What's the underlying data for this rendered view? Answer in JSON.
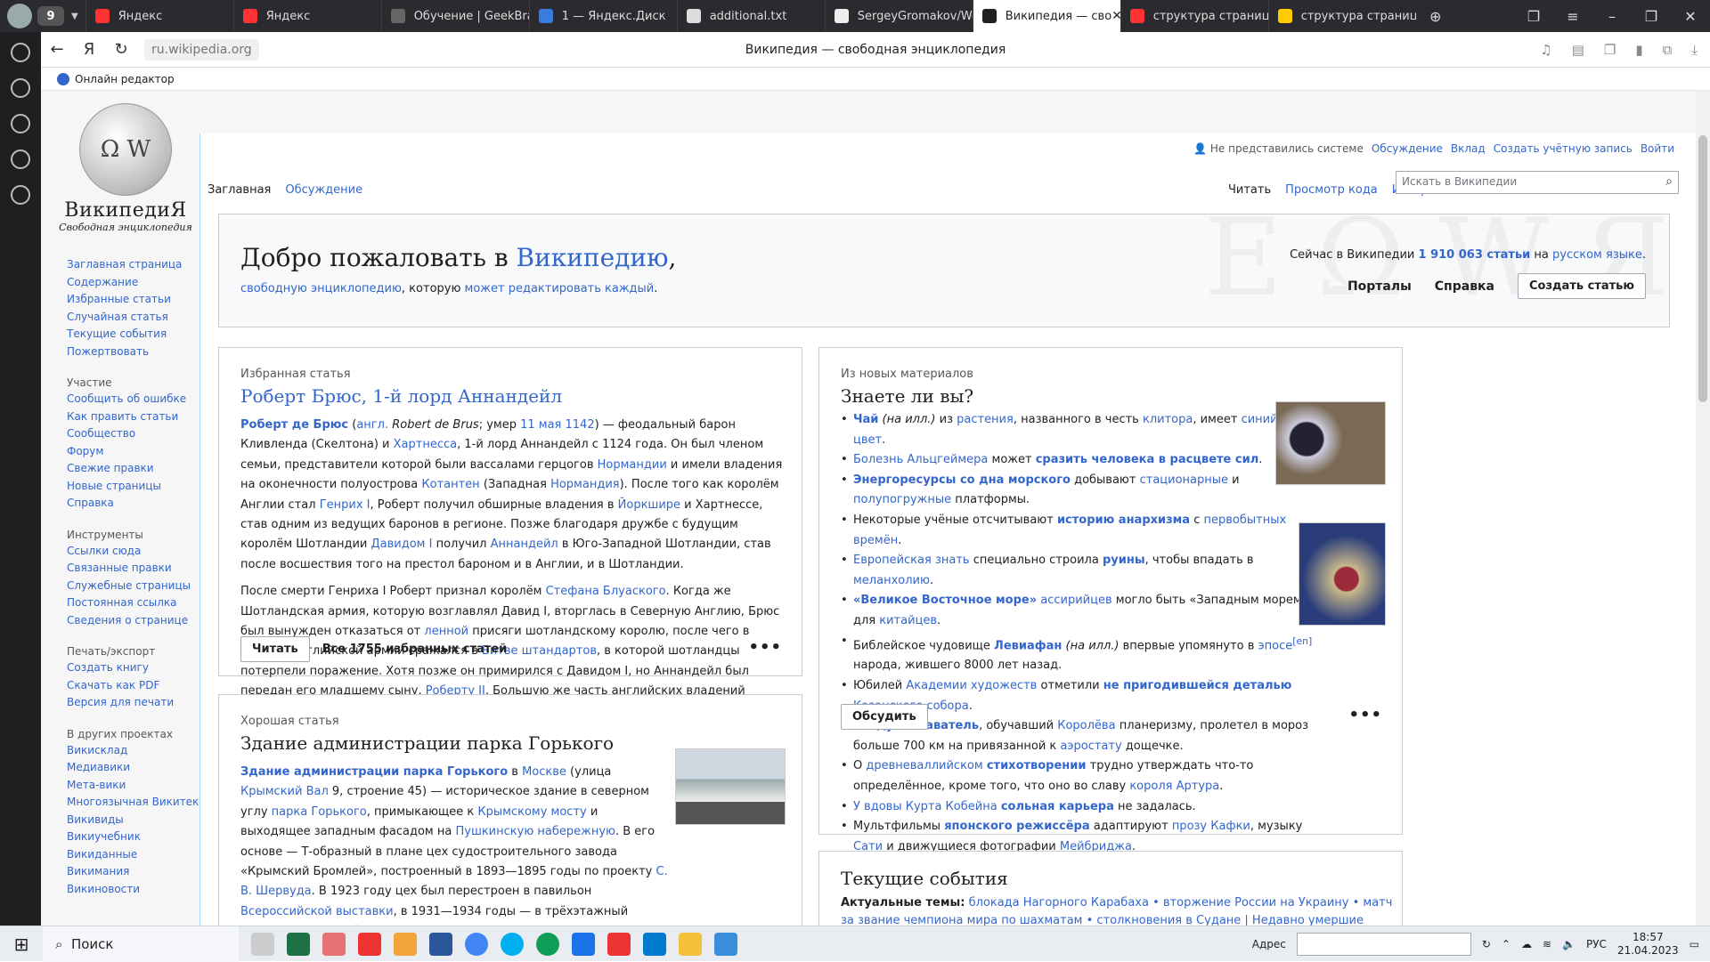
{
  "browser": {
    "tab_count": "9",
    "tabs": [
      {
        "title": "Яндекс",
        "color": "#f33"
      },
      {
        "title": "Яндекс",
        "color": "#f33"
      },
      {
        "title": "Обучение | GeekBrai",
        "color": "#666"
      },
      {
        "title": "1 — Яндекс.Диск",
        "color": "#3a7be0"
      },
      {
        "title": "additional.txt",
        "color": "#ddd"
      },
      {
        "title": "SergeyGromakov/We",
        "color": "#eee"
      },
      {
        "title": "Википедия — сво",
        "color": "#222",
        "active": true
      },
      {
        "title": "структура страницы",
        "color": "#f33"
      },
      {
        "title": "структура страницы",
        "color": "#fc0"
      }
    ],
    "url": "ru.wikipedia.org",
    "page_title": "Википедия — свободная энциклопедия",
    "bookmark": "Онлайн редактор"
  },
  "wiki": {
    "logo_name": "ВикипедиЯ",
    "logo_slogan": "Свободная энциклопедия",
    "nav_main": [
      "Заглавная страница",
      "Содержание",
      "Избранные статьи",
      "Случайная статья",
      "Текущие события",
      "Пожертвовать"
    ],
    "nav_part_title": "Участие",
    "nav_part": [
      "Сообщить об ошибке",
      "Как править статьи",
      "Сообщество",
      "Форум",
      "Свежие правки",
      "Новые страницы",
      "Справка"
    ],
    "nav_tools_title": "Инструменты",
    "nav_tools": [
      "Ссылки сюда",
      "Связанные правки",
      "Служебные страницы",
      "Постоянная ссылка",
      "Сведения о странице"
    ],
    "nav_print_title": "Печать/экспорт",
    "nav_print": [
      "Создать книгу",
      "Скачать как PDF",
      "Версия для печати"
    ],
    "nav_other_title": "В других проектах",
    "nav_other": [
      "Викисклад",
      "Медиавики",
      "Мета-вики",
      "Многоязычная Викитека",
      "Викивиды",
      "Викиучебник",
      "Викиданные",
      "Викимания",
      "Викиновости"
    ],
    "personal": {
      "user": "Не представились системе",
      "talk": "Обсуждение",
      "contrib": "Вклад",
      "create": "Создать учётную запись",
      "login": "Войти"
    },
    "ns_tabs": [
      "Заглавная",
      "Обсуждение"
    ],
    "view_tabs": [
      "Читать",
      "Просмотр кода",
      "История"
    ],
    "search_placeholder": "Искать в Википедии",
    "banner": {
      "title_a": "Добро пожаловать в ",
      "title_link": "Википедию",
      "title_b": ",",
      "sub_link1": "свободную энциклопедию",
      "sub_mid": ", которую ",
      "sub_link2": "может редактировать каждый",
      "stat_a": "Сейчас в Википедии ",
      "stat_count": "1 910 063 статьи",
      "stat_b": " на ",
      "stat_lang": "русском языке",
      "portals": "Порталы",
      "help": "Справка",
      "create": "Создать статью"
    },
    "featured": {
      "kicker": "Избранная статья",
      "title": "Роберт Брюс, 1-й лорд Аннандейл",
      "read": "Читать",
      "all": "Все 1755 избранных статей"
    },
    "good": {
      "kicker": "Хорошая статья",
      "title": "Здание администрации парка Горького"
    },
    "dyk": {
      "kicker": "Из новых материалов",
      "title": "Знаете ли вы?",
      "discuss": "Обсудить"
    },
    "news": {
      "title": "Текущие события",
      "topics_label": "Актуальные темы:",
      "topics": "блокада Нагорного Карабаха • вторжение России на Украину • матч за звание чемпиона мира по шахматам • столкновения в Судане | Недавно умершие"
    }
  },
  "taskbar": {
    "search": "Поиск",
    "addr_label": "Адрес",
    "lang": "РУС",
    "time": "18:57",
    "date": "21.04.2023"
  }
}
